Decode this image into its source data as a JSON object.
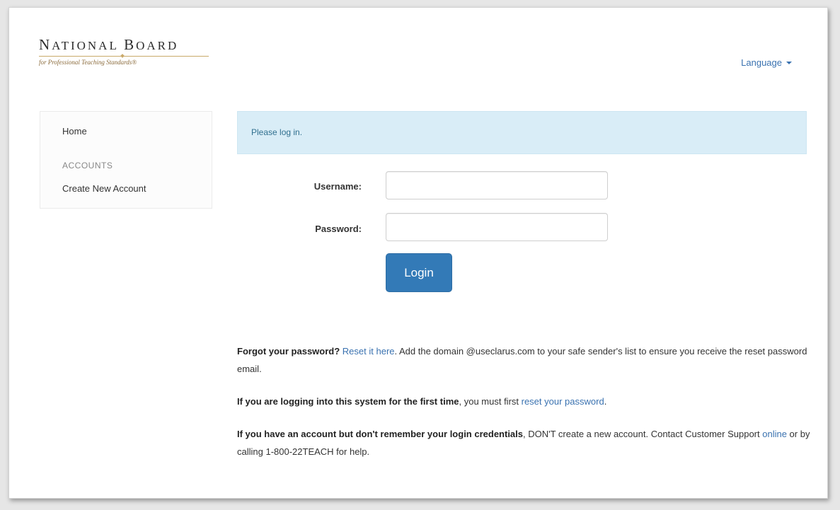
{
  "header": {
    "logo": {
      "title_first": "N",
      "title_first_rest": "ATIONAL",
      "title_second": "B",
      "title_second_rest": "OARD",
      "subtitle": "for Professional Teaching Standards®"
    },
    "language_label": "Language"
  },
  "sidebar": {
    "home": "Home",
    "section_heading": "ACCOUNTS",
    "create_account": "Create New Account"
  },
  "alert": {
    "message": "Please log in."
  },
  "form": {
    "username_label": "Username:",
    "username_value": "",
    "password_label": "Password:",
    "password_value": "",
    "login_button": "Login"
  },
  "help": {
    "forgot": {
      "bold": "Forgot your password?",
      "link": "Reset it here",
      "text": ". Add the domain @useclarus.com to your safe sender's list to ensure you receive the reset password email."
    },
    "first_time": {
      "bold": "If you are logging into this system for the first time",
      "text": ", you must first ",
      "link": "reset your password",
      "end": "."
    },
    "remember": {
      "bold": "If you have an account but don't remember your login credentials",
      "text": ", DON'T create a new account. Contact Customer Support ",
      "link": "online",
      "end": " or by calling 1-800-22TEACH for help."
    }
  },
  "colors": {
    "link": "#3a72b0",
    "alert_bg": "#d9edf7",
    "button_bg": "#337ab7"
  }
}
